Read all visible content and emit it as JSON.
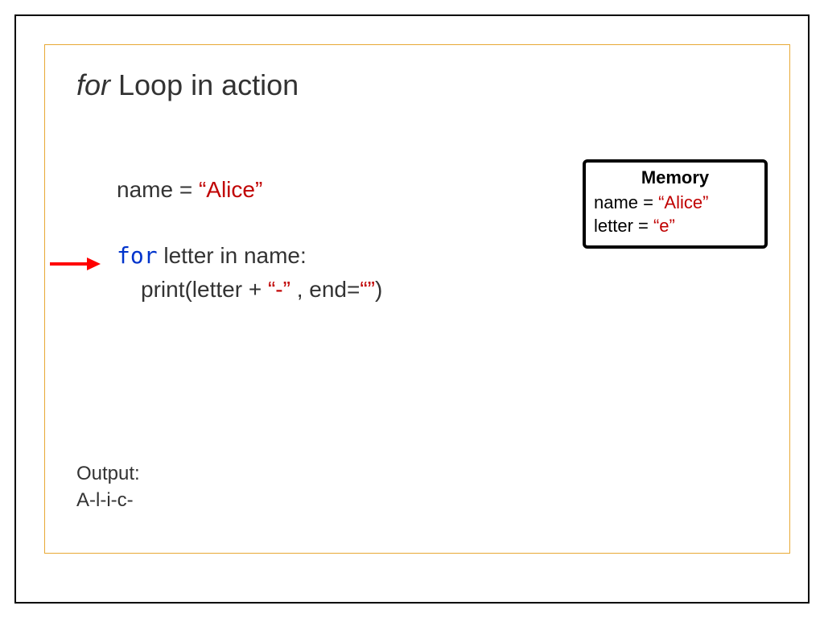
{
  "title": {
    "italic": "for",
    "rest": " Loop in action"
  },
  "code": {
    "line1_prefix": "name = ",
    "line1_string": "“Alice”",
    "line2_keyword": "for",
    "line2_rest": " letter in name:",
    "line3_prefix": "print(letter + ",
    "line3_dash": "“-”",
    "line3_mid": " , end=",
    "line3_empty": "“”",
    "line3_suffix": ")"
  },
  "memory": {
    "title": "Memory",
    "var1_label": "name = ",
    "var1_value": "“Alice”",
    "var2_label": "letter = ",
    "var2_value": "“e”"
  },
  "output": {
    "label": "Output:",
    "value": "A-l-i-c-"
  },
  "colors": {
    "string": "#c00000",
    "keyword": "#0033cc",
    "frame_accent": "#e8a935",
    "arrow": "#ff0000"
  }
}
